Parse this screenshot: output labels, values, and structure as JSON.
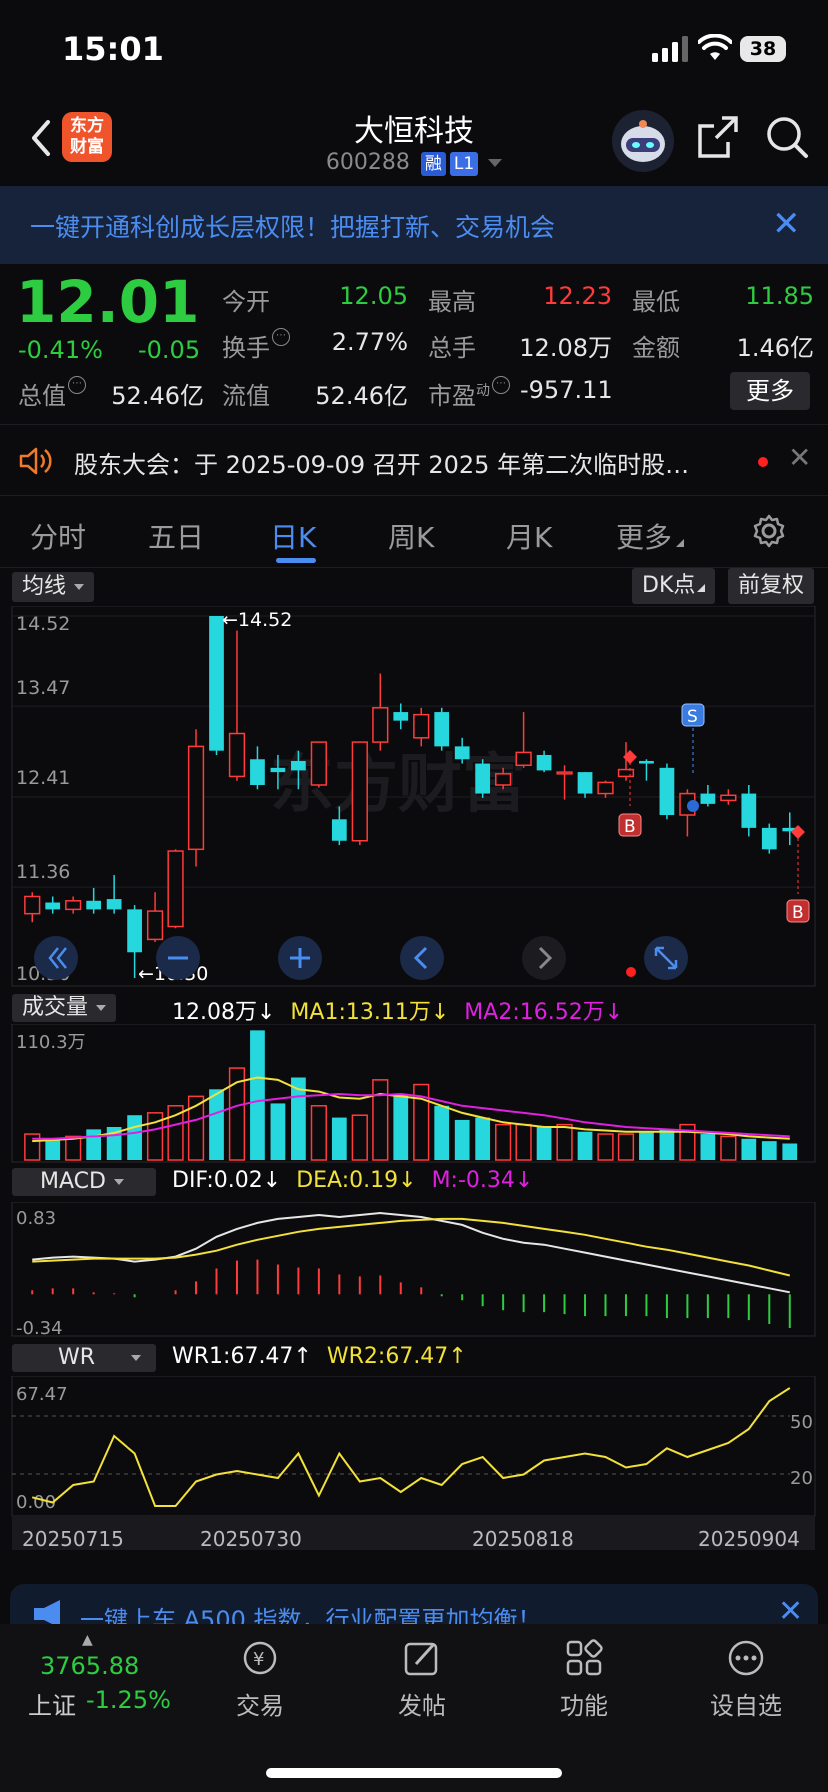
{
  "status_bar": {
    "time": "15:01",
    "battery": "38"
  },
  "header": {
    "logo_text": "东方财富",
    "stock_name": "大恒科技",
    "stock_code": "600288",
    "tag_margin": "融",
    "tag_level": "L1"
  },
  "banner": {
    "text": "一键开通科创成长层权限！把握打新、交易机会",
    "close": "✕"
  },
  "quote": {
    "price": "12.01",
    "change_pct": "-0.41%",
    "change_abs": "-0.05",
    "open_label": "今开",
    "open": "12.05",
    "high_label": "最高",
    "high": "12.23",
    "low_label": "最低",
    "low": "11.85",
    "turnover_label": "换手",
    "turnover": "2.77%",
    "volume_label": "总手",
    "volume": "12.08万",
    "amount_label": "金额",
    "amount": "1.46亿",
    "mktcap_label": "总值",
    "mktcap": "52.46亿",
    "float_label": "流值",
    "float": "52.46亿",
    "pe_label": "市盈",
    "pe_sup": "动",
    "pe": "-957.11",
    "more": "更多"
  },
  "notice": {
    "text": "股东大会：于 2025-09-09 召开 2025 年第二次临时股…",
    "close": "✕"
  },
  "tabs": [
    "分时",
    "五日",
    "日K",
    "周K",
    "月K",
    "更多"
  ],
  "active_tab": "日K",
  "kline": {
    "ma_selector": "均线",
    "dk_label": "DK点",
    "adjust_label": "前复权",
    "y_labels": [
      "14.52",
      "13.47",
      "12.41",
      "11.36",
      "10.30"
    ],
    "max_label": "←14.52",
    "min_label": "←10.30",
    "watermark": "东方财富",
    "signal_s": "S",
    "signal_b": "B"
  },
  "volume": {
    "selector": "成交量",
    "value": "12.08万",
    "ma1": "MA1:13.11万",
    "ma2": "MA2:16.52万",
    "arrow": "↓",
    "top_label": "110.3万"
  },
  "macd": {
    "selector": "MACD",
    "dif": "DIF:0.02",
    "dea": "DEA:0.19",
    "m": "M:-0.34",
    "arrow": "↓",
    "top_label": "0.83",
    "bottom_label": "-0.34"
  },
  "wr": {
    "selector": "WR",
    "wr1": "WR1:67.47",
    "wr2": "WR2:67.47",
    "arrow": "↑",
    "top_label": "67.47",
    "bottom_label": "0.00",
    "ref_high": "50",
    "ref_low": "20"
  },
  "x_dates": [
    "20250715",
    "20250730",
    "20250818",
    "20250904"
  ],
  "bottom_ad": {
    "text": "一键上车 A500 指数，行业配置更加均衡！",
    "close": "✕"
  },
  "bottom_bar": {
    "index_value": "3765.88",
    "index_name": "上证",
    "index_change": "-1.25%",
    "items": [
      "交易",
      "发帖",
      "功能",
      "设自选"
    ]
  },
  "colors": {
    "up": "#ff3b3b",
    "down": "#2ecc40",
    "candle_down": "#26d7de",
    "accent": "#4b8cf0",
    "ma1": "#f2e13a",
    "ma2": "#e020e0"
  },
  "chart_data": {
    "type": "candlestick",
    "y_range": [
      10.3,
      14.52
    ],
    "candles": [
      {
        "o": 11.05,
        "c": 11.25,
        "h": 11.3,
        "l": 10.95
      },
      {
        "o": 11.18,
        "c": 11.1,
        "h": 11.25,
        "l": 11.05
      },
      {
        "o": 11.1,
        "c": 11.2,
        "h": 11.25,
        "l": 11.05
      },
      {
        "o": 11.2,
        "c": 11.1,
        "h": 11.35,
        "l": 11.05
      },
      {
        "o": 11.22,
        "c": 11.1,
        "h": 11.5,
        "l": 11.05
      },
      {
        "o": 11.1,
        "c": 10.6,
        "h": 11.15,
        "l": 10.3
      },
      {
        "o": 10.75,
        "c": 11.08,
        "h": 11.3,
        "l": 10.72
      },
      {
        "o": 10.9,
        "c": 11.78,
        "h": 11.8,
        "l": 10.88
      },
      {
        "o": 11.8,
        "c": 13.0,
        "h": 13.2,
        "l": 11.6
      },
      {
        "o": 14.52,
        "c": 12.95,
        "h": 14.52,
        "l": 12.9
      },
      {
        "o": 12.65,
        "c": 13.15,
        "h": 14.35,
        "l": 12.6
      },
      {
        "o": 12.85,
        "c": 12.55,
        "h": 13.0,
        "l": 12.5
      },
      {
        "o": 12.75,
        "c": 12.7,
        "h": 12.9,
        "l": 12.5
      },
      {
        "o": 12.83,
        "c": 12.72,
        "h": 12.95,
        "l": 12.5
      },
      {
        "o": 12.55,
        "c": 13.05,
        "h": 13.05,
        "l": 12.52
      },
      {
        "o": 12.15,
        "c": 11.9,
        "h": 12.3,
        "l": 11.85
      },
      {
        "o": 11.9,
        "c": 13.05,
        "h": 13.05,
        "l": 11.85
      },
      {
        "o": 13.05,
        "c": 13.45,
        "h": 13.85,
        "l": 12.95
      },
      {
        "o": 13.4,
        "c": 13.3,
        "h": 13.5,
        "l": 13.2
      },
      {
        "o": 13.1,
        "c": 13.37,
        "h": 13.45,
        "l": 13.0
      },
      {
        "o": 13.4,
        "c": 13.0,
        "h": 13.45,
        "l": 12.95
      },
      {
        "o": 13.0,
        "c": 12.85,
        "h": 13.1,
        "l": 12.8
      },
      {
        "o": 12.8,
        "c": 12.45,
        "h": 12.85,
        "l": 12.4
      },
      {
        "o": 12.55,
        "c": 12.68,
        "h": 12.75,
        "l": 12.5
      },
      {
        "o": 12.78,
        "c": 12.93,
        "h": 13.4,
        "l": 12.75
      },
      {
        "o": 12.9,
        "c": 12.72,
        "h": 12.95,
        "l": 12.7
      },
      {
        "o": 12.68,
        "c": 12.7,
        "h": 12.78,
        "l": 12.38
      },
      {
        "o": 12.7,
        "c": 12.45,
        "h": 12.7,
        "l": 12.4
      },
      {
        "o": 12.45,
        "c": 12.58,
        "h": 12.6,
        "l": 12.4
      },
      {
        "o": 12.65,
        "c": 12.73,
        "h": 13.05,
        "l": 12.6
      },
      {
        "o": 12.83,
        "c": 12.8,
        "h": 12.85,
        "l": 12.6
      },
      {
        "o": 12.75,
        "c": 12.2,
        "h": 12.8,
        "l": 12.15
      },
      {
        "o": 12.2,
        "c": 12.45,
        "h": 12.5,
        "l": 11.95
      },
      {
        "o": 12.45,
        "c": 12.33,
        "h": 12.55,
        "l": 12.3
      },
      {
        "o": 12.37,
        "c": 12.43,
        "h": 12.5,
        "l": 12.32
      },
      {
        "o": 12.45,
        "c": 12.05,
        "h": 12.55,
        "l": 11.95
      },
      {
        "o": 12.05,
        "c": 11.8,
        "h": 12.1,
        "l": 11.75
      },
      {
        "o": 12.05,
        "c": 12.01,
        "h": 12.23,
        "l": 11.85
      }
    ],
    "volume_range": [
      0,
      110.3
    ],
    "volumes": [
      22,
      18,
      20,
      26,
      28,
      38,
      40,
      46,
      54,
      60,
      78,
      110,
      48,
      70,
      46,
      36,
      38,
      68,
      56,
      64,
      46,
      34,
      36,
      30,
      30,
      28,
      30,
      24,
      22,
      22,
      24,
      26,
      30,
      22,
      20,
      18,
      16,
      14
    ],
    "ma1": [
      16,
      17,
      18,
      20,
      23,
      28,
      32,
      38,
      46,
      56,
      66,
      70,
      68,
      60,
      58,
      53,
      52,
      56,
      54,
      52,
      46,
      40,
      36,
      32,
      30,
      28,
      28,
      26,
      25,
      24,
      24,
      24,
      24,
      23,
      22,
      20,
      19,
      18
    ],
    "ma2": [
      18,
      18,
      19,
      20,
      21,
      23,
      26,
      30,
      34,
      40,
      46,
      50,
      52,
      54,
      55,
      56,
      55,
      55,
      56,
      54,
      50,
      46,
      44,
      42,
      40,
      38,
      35,
      32,
      30,
      28,
      27,
      26,
      25,
      24,
      23,
      22,
      21,
      20
    ],
    "macd_range": [
      -0.34,
      0.83
    ],
    "dif": [
      0.35,
      0.37,
      0.38,
      0.37,
      0.36,
      0.33,
      0.35,
      0.38,
      0.46,
      0.58,
      0.66,
      0.72,
      0.76,
      0.78,
      0.8,
      0.78,
      0.8,
      0.82,
      0.8,
      0.78,
      0.74,
      0.7,
      0.62,
      0.56,
      0.52,
      0.5,
      0.46,
      0.42,
      0.38,
      0.34,
      0.3,
      0.26,
      0.22,
      0.18,
      0.14,
      0.1,
      0.06,
      0.02
    ],
    "dea": [
      0.33,
      0.34,
      0.35,
      0.36,
      0.36,
      0.36,
      0.36,
      0.37,
      0.4,
      0.44,
      0.5,
      0.55,
      0.59,
      0.63,
      0.66,
      0.68,
      0.7,
      0.72,
      0.74,
      0.75,
      0.76,
      0.76,
      0.74,
      0.72,
      0.69,
      0.66,
      0.63,
      0.6,
      0.56,
      0.52,
      0.48,
      0.45,
      0.41,
      0.37,
      0.33,
      0.29,
      0.24,
      0.19
    ],
    "macd": [
      0.04,
      0.06,
      0.06,
      0.02,
      0.01,
      -0.03,
      0.0,
      0.04,
      0.13,
      0.26,
      0.34,
      0.35,
      0.3,
      0.27,
      0.26,
      0.2,
      0.18,
      0.19,
      0.12,
      0.07,
      -0.02,
      -0.06,
      -0.12,
      -0.16,
      -0.18,
      -0.18,
      -0.2,
      -0.22,
      -0.22,
      -0.22,
      -0.22,
      -0.24,
      -0.24,
      -0.24,
      -0.24,
      -0.26,
      -0.3,
      -0.34
    ],
    "wr_range": [
      0,
      67.47
    ],
    "wr": [
      5,
      2,
      12,
      14,
      40,
      30,
      0,
      0,
      14,
      18,
      20,
      18,
      16,
      30,
      6,
      30,
      14,
      16,
      8,
      16,
      12,
      24,
      28,
      16,
      18,
      26,
      28,
      30,
      28,
      22,
      24,
      33,
      28,
      32,
      36,
      44,
      60,
      67.47
    ]
  }
}
